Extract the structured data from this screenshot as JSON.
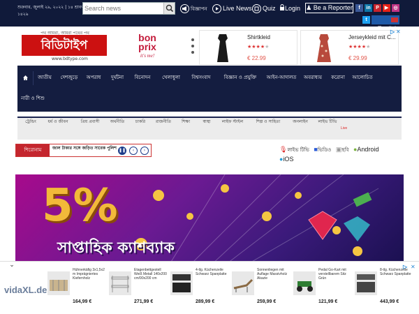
{
  "topbar": {
    "date": "শুক্রবার, জুলাই ২৯, ২০২২ | ১৪ শ্রাবণ ১৪২৯",
    "search_placeholder": "Search news",
    "links": {
      "ad": "বিজ্ঞাপন",
      "live": "Live News",
      "quiz": "Quiz",
      "login": "Login",
      "reporter": "Be a Reporter"
    },
    "social": [
      "f",
      "in",
      "♪",
      "P",
      "▶",
      "◎",
      "t"
    ],
    "english": "English"
  },
  "header": {
    "tagline": "পথ আমরা, আমরা পথের পথ",
    "logo": "বিডিটাইপ",
    "url": "www.bdtype.com",
    "bonprix_brand": "bon prix",
    "bonprix_slogan": "it's me!",
    "products": [
      {
        "name": "Shirtkleid",
        "rating": 4,
        "price": "€ 22.99"
      },
      {
        "name": "Jerseykleid mit C...",
        "rating": 4,
        "price": "€ 29.99"
      }
    ]
  },
  "nav": {
    "home_icon": "home-icon",
    "row1": [
      "জাতীয়",
      "দেশজুড়ে",
      "অপরাধ",
      "দুর্ঘটনা",
      "বিনোদন",
      "খেলাধুলা",
      "বিশ্বসংবাদ",
      "বিজ্ঞান ও প্রযুক্তি",
      "আইন-আদালত",
      "অবরাধ্যয়",
      "করোনা",
      "আলোচিত"
    ],
    "row1b": [
      "নারী ও শিশু"
    ],
    "row2": [
      "ট্রেন্ডিং",
      "ধর্ম ও জীবন",
      "প্রিয় প্রবাসী",
      "অর্থনীতি",
      "চাকরি",
      "রাজনীতি",
      "শিক্ষা",
      "স্বাস্থ্য",
      "লাইফ স্টাইল",
      "শিল্প ও সাহিত্য",
      "অনলাইন",
      "লাইভ টিভি"
    ],
    "live_badge": "Live"
  },
  "headline": {
    "label": "শিরোনাম",
    "text": "জাল টাকার সঙ্গে জড়িত সাবেক পুলিশ"
  },
  "media": {
    "live_tv": "লাইভ টিভি",
    "video": "ভিডিও",
    "photo": "ছবি",
    "android": "Android",
    "ios": "iOS"
  },
  "banner": {
    "percent": "5%",
    "title": "সাপ্তাহিক ক্যাশব্যাক"
  },
  "bottom_ad": {
    "brand": "vidaXL.de",
    "items": [
      {
        "name": "Hühnerkäfig 3x1,5x2 m Imprägniertes Kiefernholz",
        "price": "164,99 €"
      },
      {
        "name": "Etagenbettgestell Weiß Metall 140x200 cm/90x200 cm",
        "price": "271,99 €"
      },
      {
        "name": "4-tlg. Küchenzeile Schwarz Spanplatte",
        "price": "289,99 €"
      },
      {
        "name": "Sonnenliegen mit Auflage Massivholz Akazie",
        "price": "259,99 €"
      },
      {
        "name": "Pedal Go-Kart mit verstellbarem Sitz Grün",
        "price": "121,99 €"
      },
      {
        "name": "8-tlg. Küchenzeile Schwarz Spanplatte",
        "price": "443,99 €"
      }
    ]
  },
  "colors": {
    "navy": "#141d40",
    "red": "#c4262e",
    "accent_blue": "#1e5aa8"
  }
}
